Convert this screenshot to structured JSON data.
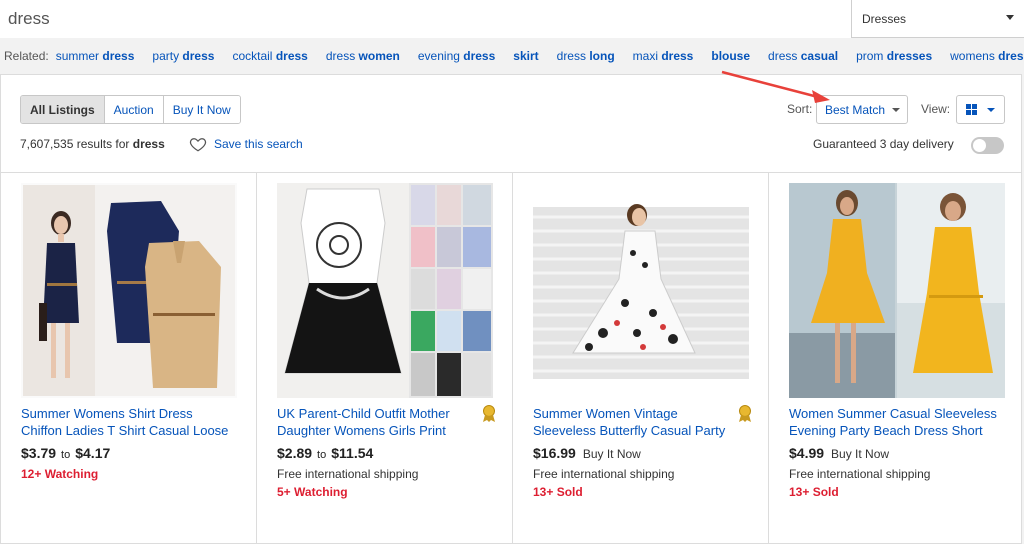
{
  "search": {
    "query": "dress",
    "category": "Dresses",
    "colors": {
      "link": "#0654ba",
      "hot": "#dd1e31",
      "arrow": "#e8413a"
    }
  },
  "related": {
    "label": "Related:",
    "items": [
      {
        "pre": "summer ",
        "bold": "dress",
        "post": ""
      },
      {
        "pre": "party ",
        "bold": "dress",
        "post": ""
      },
      {
        "pre": "cocktail ",
        "bold": "dress",
        "post": ""
      },
      {
        "pre": "dress ",
        "bold": "women",
        "post": ""
      },
      {
        "pre": "evening ",
        "bold": "dress",
        "post": ""
      },
      {
        "pre": "",
        "bold": "skirt",
        "post": ""
      },
      {
        "pre": "dress ",
        "bold": "long",
        "post": ""
      },
      {
        "pre": "maxi ",
        "bold": "dress",
        "post": ""
      },
      {
        "pre": "",
        "bold": "blouse",
        "post": ""
      },
      {
        "pre": "dress ",
        "bold": "casual",
        "post": ""
      },
      {
        "pre": "prom ",
        "bold": "dresses",
        "post": ""
      },
      {
        "pre": "womens ",
        "bold": "dresse",
        "post": "..."
      }
    ]
  },
  "tabs": [
    "All Listings",
    "Auction",
    "Buy It Now"
  ],
  "results": {
    "count": "7,607,535",
    "mid": " results for ",
    "query": "dress",
    "save_label": "Save this search"
  },
  "sort": {
    "label": "Sort:",
    "value": "Best Match"
  },
  "view": {
    "label": "View:",
    "icon": "grid-icon"
  },
  "delivery": {
    "label": "Guaranteed 3 day delivery",
    "enabled": false
  },
  "listings": [
    {
      "title_line1": "Summer Womens Shirt Dress",
      "title_line2": "Chiffon Ladies T Shirt Casual Loose",
      "price_from": "$3.79",
      "price_sep": "to",
      "price_to": "$4.17",
      "format": "",
      "shipping": "",
      "hot": "12+ Watching",
      "top_rated": false
    },
    {
      "title_line1": "UK Parent-Child Outfit Mother",
      "title_line2": "Daughter Womens Girls Print",
      "price_from": "$2.89",
      "price_sep": "to",
      "price_to": "$11.54",
      "format": "",
      "shipping": "Free international shipping",
      "hot": "5+ Watching",
      "top_rated": true
    },
    {
      "title_line1": "Summer Women Vintage",
      "title_line2": "Sleeveless Butterfly Casual Party",
      "price_from": "$16.99",
      "price_sep": "",
      "price_to": "",
      "format": "Buy It Now",
      "shipping": "Free international shipping",
      "hot": "13+ Sold",
      "top_rated": true
    },
    {
      "title_line1": "Women Summer Casual Sleeveless",
      "title_line2": "Evening Party Beach Dress Short",
      "price_from": "$4.99",
      "price_sep": "",
      "price_to": "",
      "format": "Buy It Now",
      "shipping": "Free international shipping",
      "hot": "13+ Sold",
      "top_rated": false
    }
  ]
}
